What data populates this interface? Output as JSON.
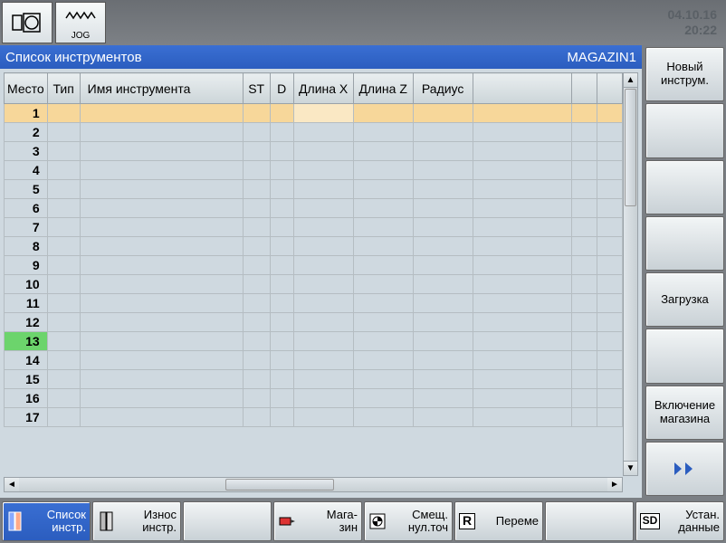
{
  "datetime": {
    "date": "04.10.16",
    "time": "20:22"
  },
  "top_icons": {
    "jog_label": "JOG"
  },
  "titlebar": {
    "left": "Список инструментов",
    "right": "MAGAZIN1"
  },
  "columns": {
    "place": "Место",
    "type": "Тип",
    "name": "Имя инструмента",
    "st": "ST",
    "d": "D",
    "lx": "Длина X",
    "lz": "Длина Z",
    "r": "Радиус"
  },
  "rows": [
    {
      "n": "1",
      "selected": true
    },
    {
      "n": "2"
    },
    {
      "n": "3"
    },
    {
      "n": "4"
    },
    {
      "n": "5"
    },
    {
      "n": "6"
    },
    {
      "n": "7"
    },
    {
      "n": "8"
    },
    {
      "n": "9"
    },
    {
      "n": "10"
    },
    {
      "n": "11"
    },
    {
      "n": "12"
    },
    {
      "n": "13",
      "green": true
    },
    {
      "n": "14"
    },
    {
      "n": "15"
    },
    {
      "n": "16"
    },
    {
      "n": "17"
    }
  ],
  "side_buttons": {
    "b1": "Новый\nинструм.",
    "b2": "",
    "b3": "",
    "b4": "",
    "b5": "Загрузка",
    "b6": "",
    "b7": "Включение магазина",
    "b8_icon": "double-arrow-right"
  },
  "bottom_buttons": {
    "b1": "Список\nинстр.",
    "b2": "Износ\nинстр.",
    "b3": "",
    "b4": "Мага-\nзин",
    "b5": "Смещ.\nнул.точ",
    "b6": "Переме",
    "b7": "",
    "b8": "Устан.\nданные",
    "b6_icon_label": "R",
    "b8_icon_label": "SD"
  }
}
